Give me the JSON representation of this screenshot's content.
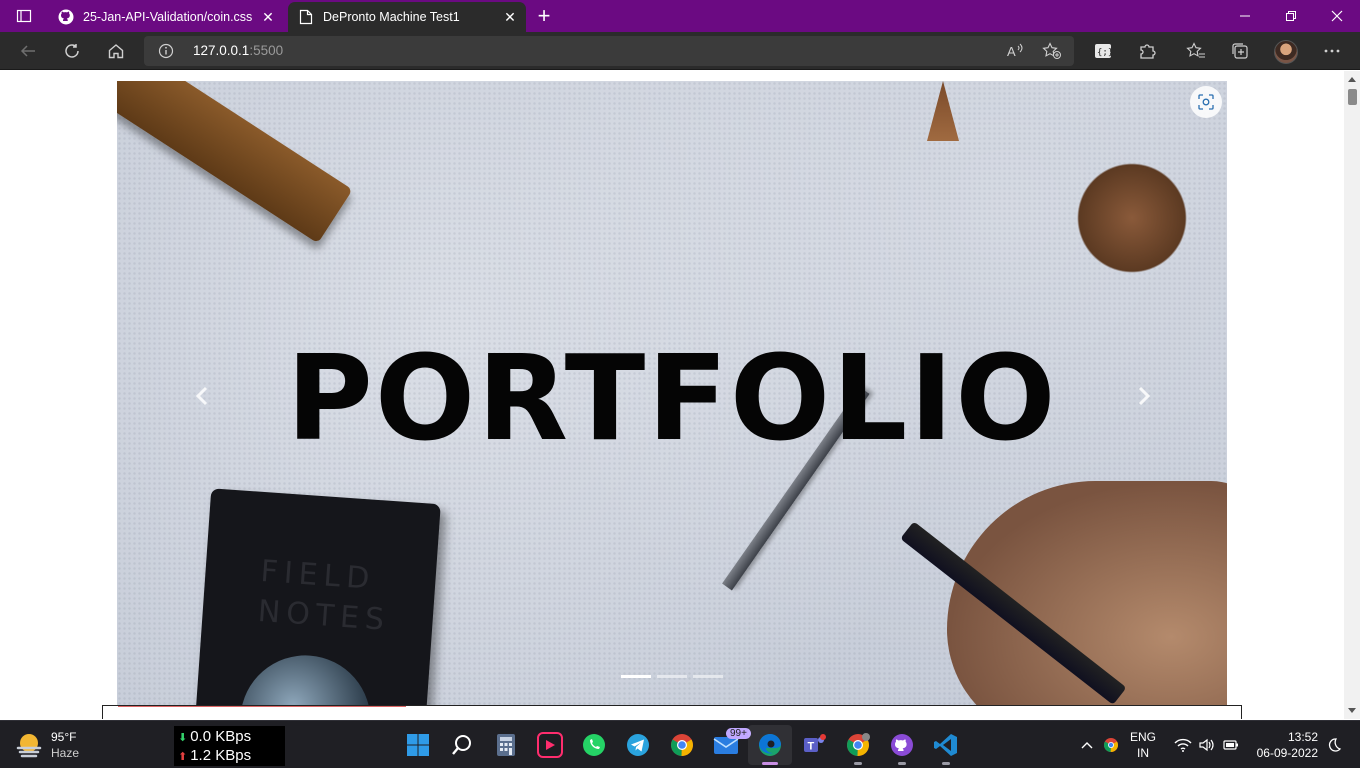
{
  "browser": {
    "tabs": [
      {
        "title": "25-Jan-API-Validation/coin.css at",
        "icon": "github-icon"
      },
      {
        "title": "DePronto Machine Test1",
        "icon": "page-icon"
      }
    ],
    "address": {
      "host": "127.0.0.1",
      "port": ":5500"
    }
  },
  "page": {
    "hero_text": "PORTFOLIO",
    "notebook_text": "FIELD NOTES",
    "slide_count": 3,
    "active_slide": 1
  },
  "taskbar": {
    "weather": {
      "temp": "95°F",
      "condition": "Haze"
    },
    "net": {
      "down": "0.0 KBps",
      "up": "1.2 KBps"
    },
    "mail_badge": "99+",
    "lang": {
      "line1": "ENG",
      "line2": "IN"
    },
    "time": "13:52",
    "date": "06-09-2022"
  },
  "colors": {
    "titlebar": "#6b0a82",
    "toolbar": "#2b2b2b",
    "taskbar": "#1f1f24"
  }
}
